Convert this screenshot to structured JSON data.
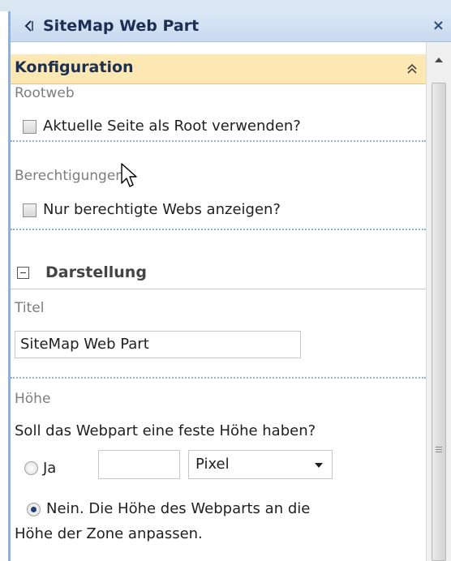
{
  "webpart": {
    "title": "SiteMap Web Part",
    "close_label": "×"
  },
  "section": {
    "label": "Konfiguration"
  },
  "rootweb": {
    "label": "Rootweb",
    "checkbox_label": "Aktuelle Seite als Root verwenden?"
  },
  "berechtigungen": {
    "label": "Berechtigungen",
    "checkbox_label": "Nur berechtigte Webs anzeigen?"
  },
  "darstellung": {
    "label": "Darstellung"
  },
  "titel": {
    "label": "Titel",
    "value": "SiteMap Web Part"
  },
  "hoehe": {
    "label": "Höhe",
    "question": "Soll das Webpart eine feste Höhe haben?",
    "option_yes": "Ja",
    "height_value": "",
    "unit_selected": "Pixel",
    "option_no_line1": "Nein. Die Höhe des Webparts an die",
    "option_no_line2": "Höhe der Zone anpassen."
  },
  "colors": {
    "header_bg": "#c9d9ef",
    "section_bg": "#fde7b3",
    "accent": "#1b2f52"
  },
  "icons": {
    "collapse": "chevron-left-icon",
    "section_toggle": "double-chevron-up-icon",
    "group_toggle": "minus-box-icon"
  }
}
